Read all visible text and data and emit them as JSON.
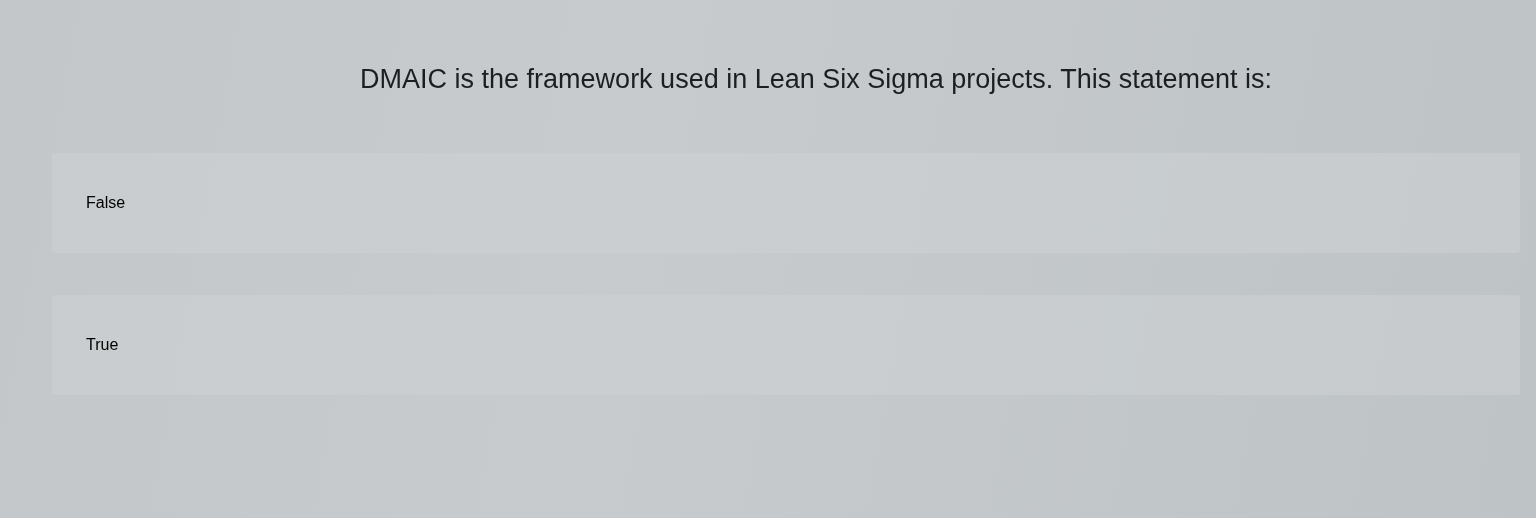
{
  "question": "DMAIC is the framework used in Lean Six Sigma projects. This statement is:",
  "options": [
    {
      "label": "False"
    },
    {
      "label": "True"
    }
  ]
}
